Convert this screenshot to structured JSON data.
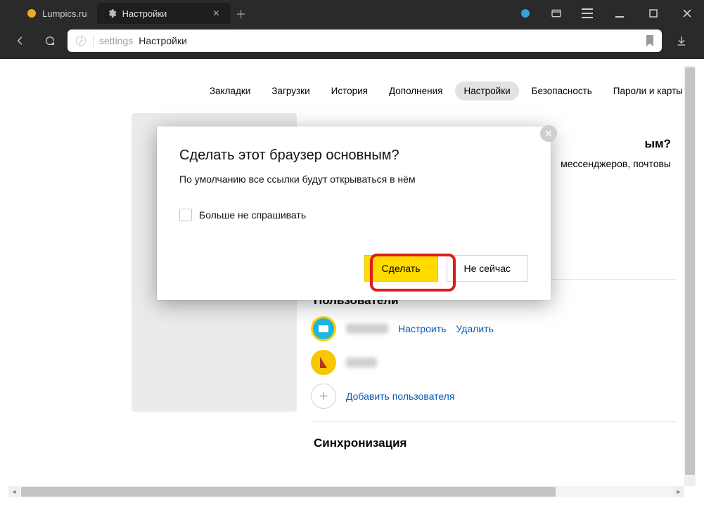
{
  "tabs": [
    {
      "label": "Lumpics.ru",
      "active": false
    },
    {
      "label": "Настройки",
      "active": true
    }
  ],
  "address": {
    "prefix": "settings",
    "text": "Настройки"
  },
  "nav": {
    "items": [
      "Закладки",
      "Загрузки",
      "История",
      "Дополнения",
      "Настройки",
      "Безопасность",
      "Пароли и карты"
    ],
    "active_index": 4
  },
  "peek": {
    "heading_fragment": "ым?",
    "line_fragment": "мессенджеров, почтовы"
  },
  "users": {
    "title": "Пользователи",
    "configure": "Настроить",
    "remove": "Удалить",
    "add": "Добавить пользователя"
  },
  "sync": {
    "title": "Синхронизация"
  },
  "modal": {
    "title": "Сделать этот браузер основным?",
    "subtitle": "По умолчанию все ссылки будут открываться в нём",
    "checkbox": "Больше не спрашивать",
    "primary": "Сделать",
    "secondary": "Не сейчас"
  },
  "colors": {
    "accent": "#ffdb00",
    "ring": "#e11b1b"
  }
}
